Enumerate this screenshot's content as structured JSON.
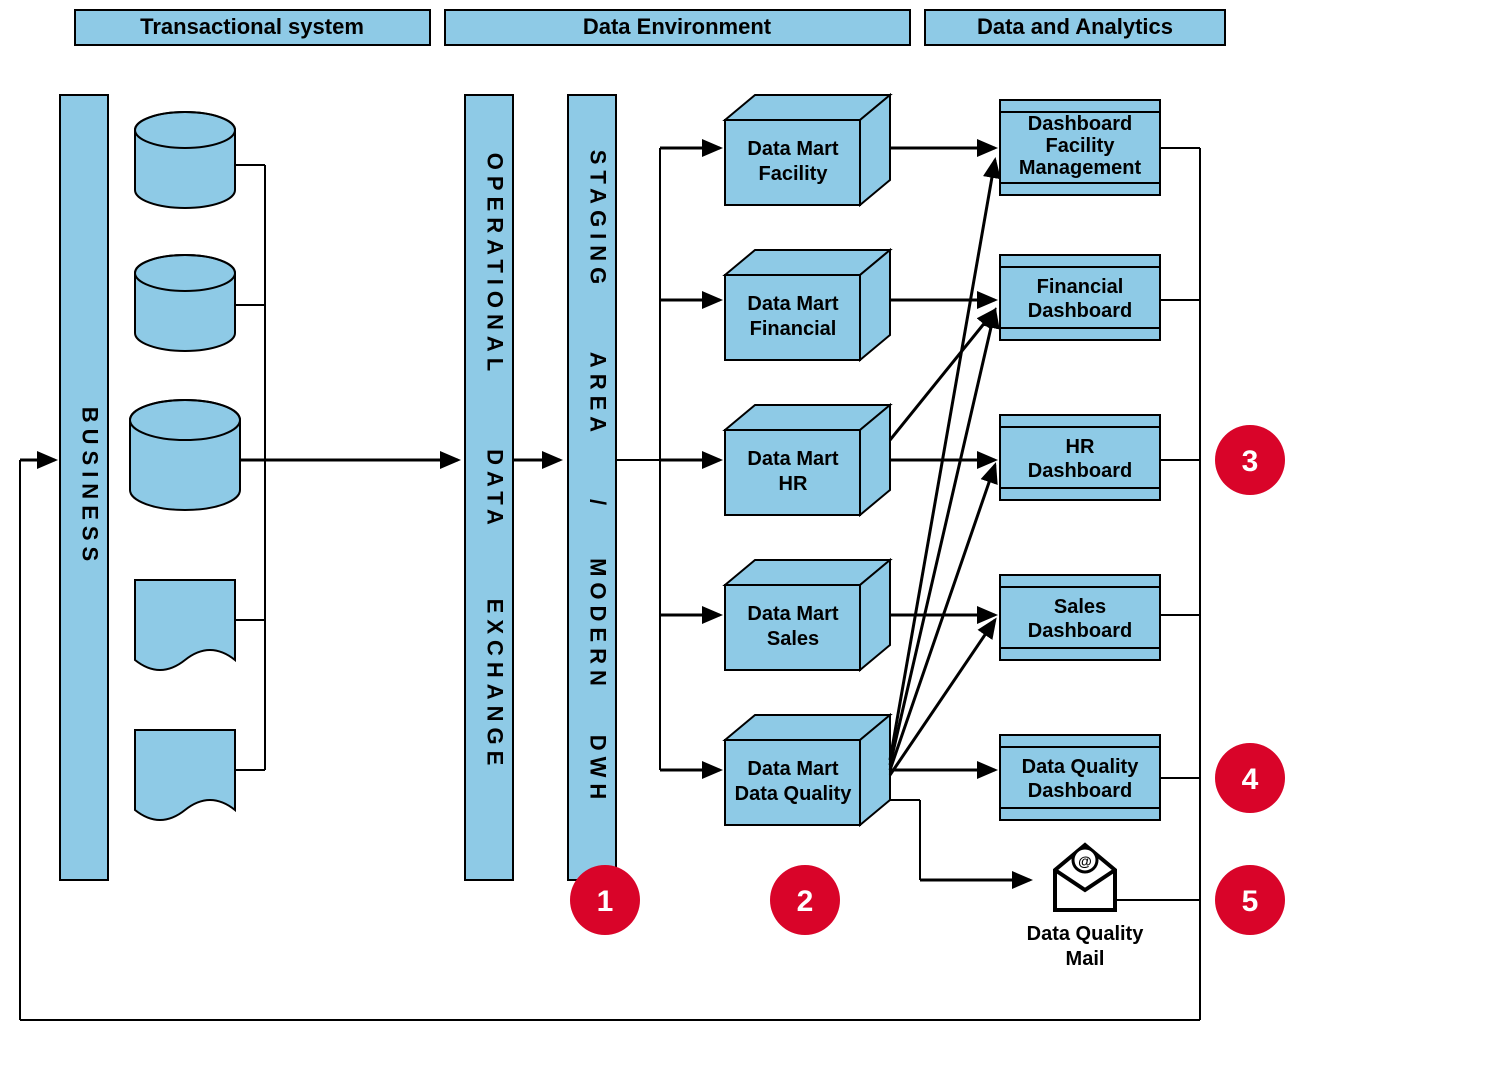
{
  "headers": {
    "h1": "Transactional system",
    "h2": "Data Environment",
    "h3": "Data and Analytics"
  },
  "business": {
    "label": "BUSINESS"
  },
  "odx": {
    "l1": "OPERATIONAL",
    "l2": "DATA",
    "l3": "EXCHANGE"
  },
  "staging": {
    "l1": "STAGING",
    "l2": "AREA",
    "l3": "/",
    "l4": "MODERN",
    "l5": "DWH"
  },
  "marts": {
    "m1a": "Data Mart",
    "m1b": "Facility",
    "m2a": "Data Mart",
    "m2b": "Financial",
    "m3a": "Data Mart",
    "m3b": "HR",
    "m4a": "Data Mart",
    "m4b": "Sales",
    "m5a": "Data Mart",
    "m5b": "Data Quality"
  },
  "dash": {
    "d1a": "Dashboard",
    "d1b": "Facility",
    "d1c": "Management",
    "d2a": "Financial",
    "d2b": "Dashboard",
    "d3a": "HR",
    "d3b": "Dashboard",
    "d4a": "Sales",
    "d4b": "Dashboard",
    "d5a": "Data Quality",
    "d5b": "Dashboard"
  },
  "mail": {
    "l1": "Data Quality",
    "l2": "Mail"
  },
  "badges": {
    "b1": "1",
    "b2": "2",
    "b3": "3",
    "b4": "4",
    "b5": "5"
  }
}
